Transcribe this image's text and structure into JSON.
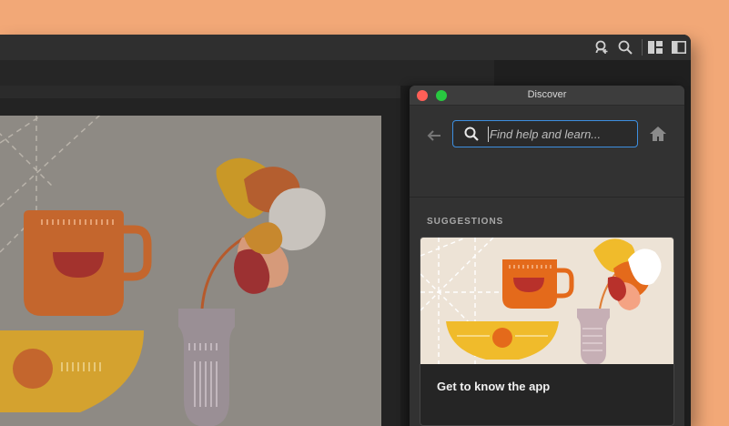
{
  "titlebar": {
    "icons": [
      "user-plus-icon",
      "search-icon",
      "layout-grid-icon",
      "panel-toggle-icon"
    ]
  },
  "discover_panel": {
    "title": "Discover",
    "search": {
      "placeholder": "Find help and learn...",
      "value": ""
    },
    "section_label": "SUGGESTIONS",
    "cards": [
      {
        "title": "Get to know the app"
      }
    ]
  },
  "colors": {
    "desktop": "#f2a877",
    "app_bg": "#1e1e1e",
    "panel_bg": "#323232",
    "accent": "#3d8fe0",
    "close_light": "#ff5f57",
    "zoom_light": "#28c840"
  }
}
